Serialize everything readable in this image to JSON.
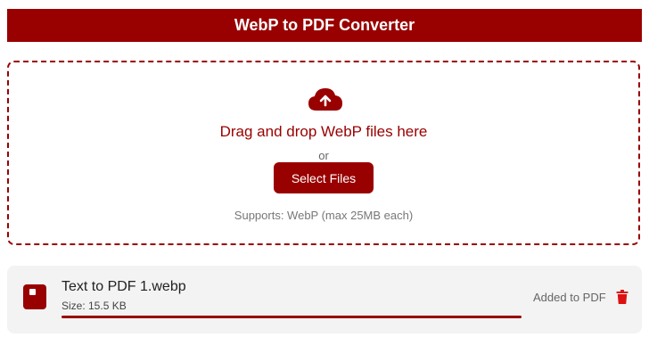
{
  "header": {
    "title": "WebP to PDF Converter"
  },
  "dropzone": {
    "icon": "cloud-upload-icon",
    "drag_text": "Drag and drop WebP files here",
    "or_text": "or",
    "select_label": "Select Files",
    "supports_text": "Supports: WebP (max 25MB each)"
  },
  "files": [
    {
      "icon": "file-icon",
      "name": "Text to PDF 1.webp",
      "size": "Size: 15.5 KB",
      "progress": 1.0,
      "status": "Added to PDF",
      "delete_icon": "trash-icon"
    }
  ],
  "colors": {
    "accent": "#990000",
    "card_bg": "#f3f3f3"
  }
}
